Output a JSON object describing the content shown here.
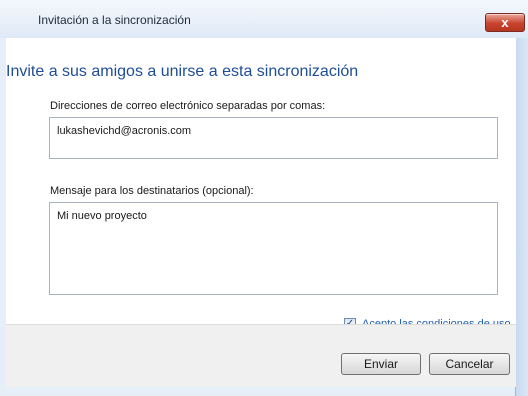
{
  "window": {
    "title": "Invitación a la sincronización",
    "close_label": "x"
  },
  "heading": "Invite a sus amigos a unirse a esta sincronización",
  "emails": {
    "label": "Direcciones de correo electrónico separadas por comas:",
    "value": "lukashevichd@acronis.com"
  },
  "message": {
    "label": "Mensaje para los destinatarios (opcional):",
    "value": "Mi nuevo proyecto"
  },
  "terms": {
    "checked": true,
    "label": "Acepto las condiciones de uso"
  },
  "buttons": {
    "send": "Enviar",
    "cancel": "Cancelar"
  }
}
